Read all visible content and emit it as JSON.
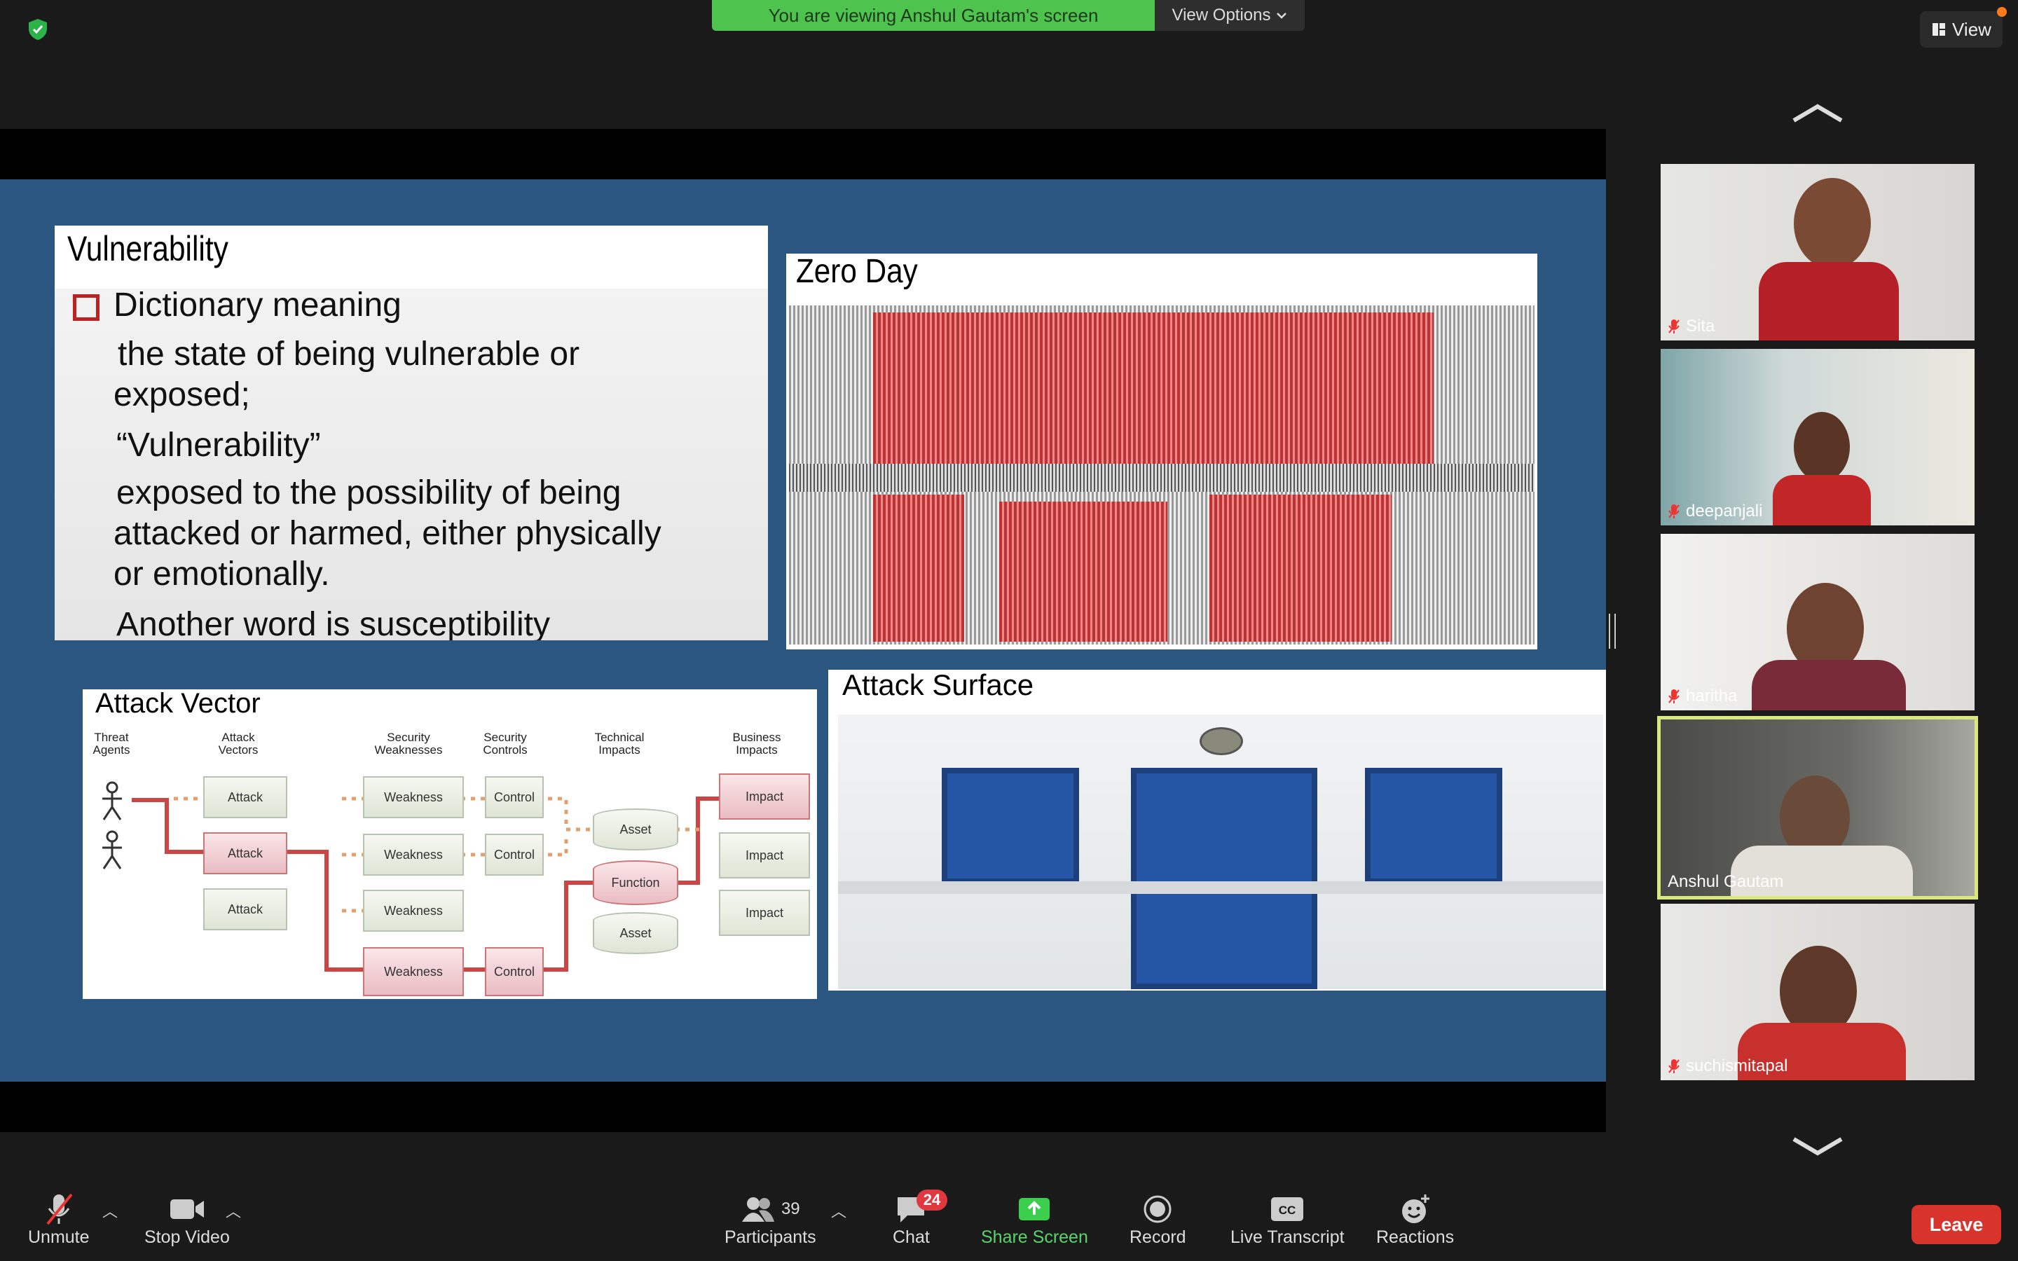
{
  "banner": {
    "text": "You are viewing Anshul Gautam's screen",
    "options": "View Options"
  },
  "view_button": "View",
  "slide": {
    "vulnerability": {
      "title": "Vulnerability",
      "lines": [
        "Dictionary meaning",
        "the state of being vulnerable or",
        "exposed;",
        "“Vulnerability”",
        "exposed to the possibility of being",
        "attacked or harmed, either physically",
        "or emotionally.",
        "Another word is susceptibility"
      ]
    },
    "zero_day": {
      "title": "Zero Day"
    },
    "attack_vector": {
      "title": "Attack Vector",
      "headers": [
        "Threat\nAgents",
        "Attack\nVectors",
        "Security\nWeaknesses",
        "Security\nControls",
        "Technical\nImpacts",
        "Business\nImpacts"
      ],
      "attack": "Attack",
      "weakness": "Weakness",
      "control": "Control",
      "asset": "Asset",
      "function": "Function",
      "impact": "Impact"
    },
    "attack_surface": {
      "title": "Attack Surface"
    }
  },
  "participants": [
    {
      "name": "Sita",
      "muted": true
    },
    {
      "name": "deepanjali",
      "muted": true
    },
    {
      "name": "haritha",
      "muted": true
    },
    {
      "name": "Anshul Gautam",
      "muted": false,
      "active": true
    },
    {
      "name": "suchismitapal",
      "muted": true
    }
  ],
  "toolbar": {
    "unmute": "Unmute",
    "stop_video": "Stop Video",
    "participants": "Participants",
    "participants_count": "39",
    "chat": "Chat",
    "chat_badge": "24",
    "share_screen": "Share Screen",
    "record": "Record",
    "live_transcript": "Live Transcript",
    "reactions": "Reactions",
    "leave": "Leave"
  },
  "colors": {
    "banner_green": "#4ec34e",
    "share_green": "#3ccf4e",
    "leave_red": "#d8342c",
    "slide_blue": "#2b5680"
  }
}
